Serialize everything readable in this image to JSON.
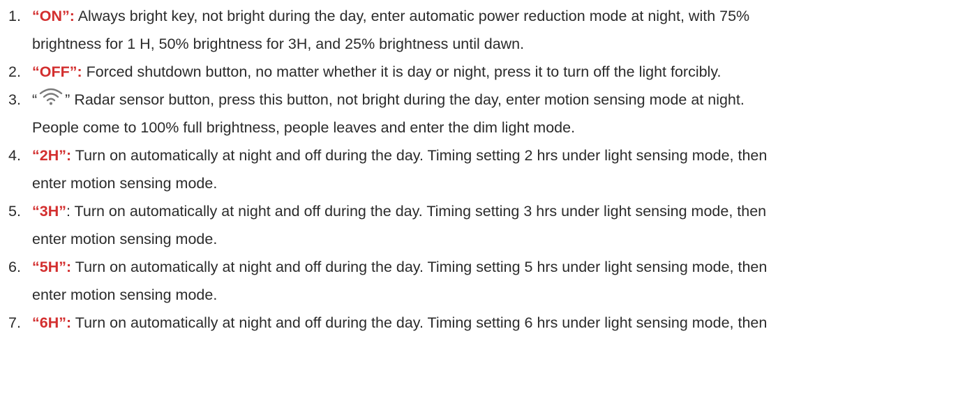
{
  "items": [
    {
      "number": "1.",
      "key": "“ON”:",
      "line1": " Always bright key, not bright during the day, enter automatic power reduction mode at night, with 75%",
      "line2": "brightness for 1 H, 50% brightness for 3H, and 25% brightness until dawn."
    },
    {
      "number": "2.",
      "key": "“OFF”:",
      "line1": " Forced shutdown button, no matter whether it is day or night, press it to turn off the light forcibly."
    },
    {
      "number": "3.",
      "open_quote": "“",
      "icon": "wifi-icon",
      "close_quote": "”",
      "line1": " Radar sensor button, press this button, not bright during the day, enter motion sensing mode at night.",
      "line2": "People come to 100% full brightness, people leaves and enter the dim light mode."
    },
    {
      "number": "4.",
      "key": "“2H”:",
      "line1": " Turn on automatically at night and off during the day. Timing setting 2 hrs under light sensing mode, then",
      "line2": "enter motion sensing mode."
    },
    {
      "number": "5.",
      "key": "“3H”",
      "line1": ": Turn on automatically at night and off during the day. Timing setting 3 hrs under light sensing mode, then",
      "line2": "enter motion sensing mode."
    },
    {
      "number": "6.",
      "key": "“5H”:",
      "line1": " Turn on automatically at night and off during the day. Timing setting 5 hrs under light sensing mode, then",
      "line2": "enter motion sensing mode."
    },
    {
      "number": "7.",
      "key": "“6H”:",
      "line1": " Turn on automatically at night and off during the day. Timing setting 6 hrs under light sensing mode, then"
    }
  ],
  "colors": {
    "text": "#2b2b2b",
    "key": "#d32f2f"
  }
}
